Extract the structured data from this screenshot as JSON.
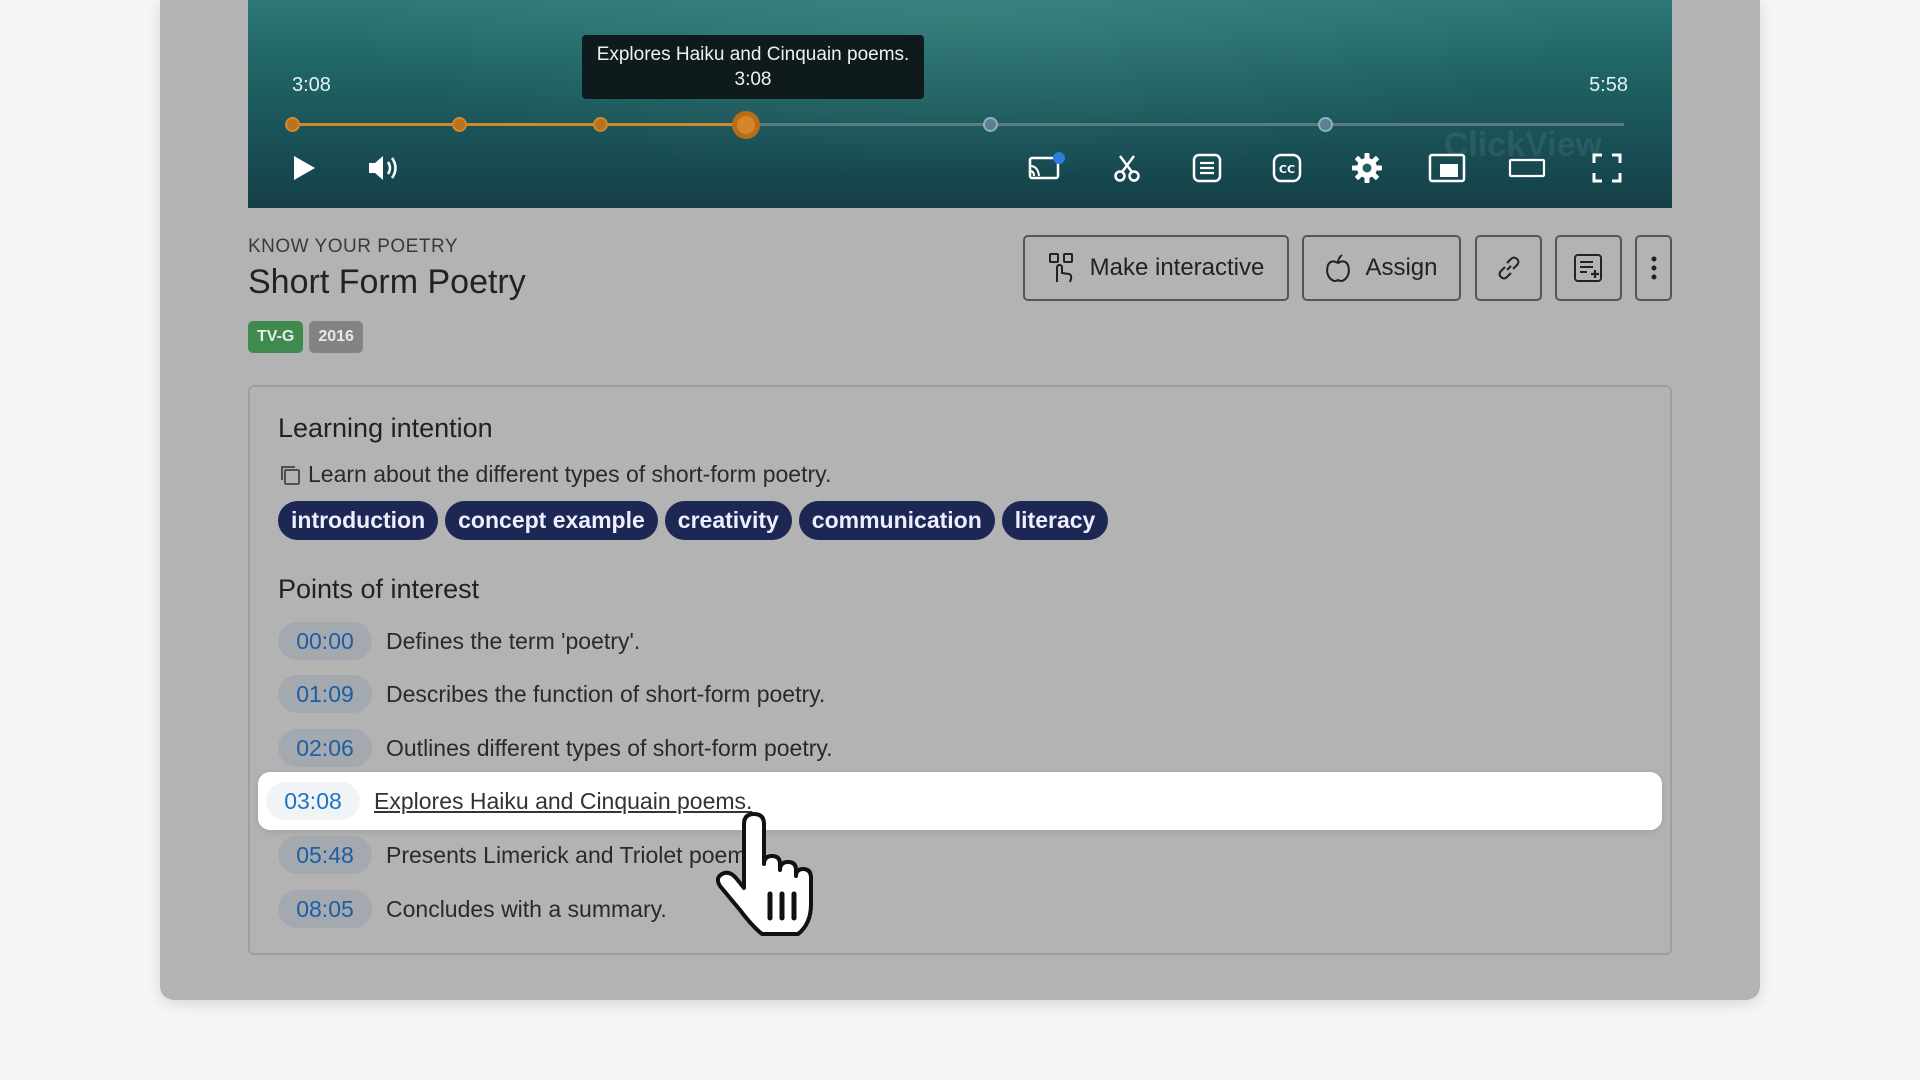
{
  "player": {
    "current_time": "3:08",
    "duration": "5:58",
    "progress_fraction": 0.3408,
    "tooltip_text": "Explores Haiku and Cinquain poems.",
    "tooltip_time": "3:08",
    "chapter_marker_fractions": [
      0,
      0.1256,
      0.2312,
      0.524,
      0.7752
    ],
    "watermark": "ClickView",
    "controls": [
      "play-icon",
      "volume-icon",
      "cast-icon",
      "clip-scissors-icon",
      "transcript-icon",
      "closed-captions-icon",
      "settings-gear-icon",
      "picture-in-picture-icon",
      "theater-mode-icon",
      "fullscreen-icon"
    ],
    "colors": {
      "progress": "#d5862b",
      "cast_dot": "#2b7be0"
    }
  },
  "video": {
    "series": "KNOW YOUR POETRY",
    "title": "Short Form Poetry",
    "rating": "TV-G",
    "year": "2016"
  },
  "toolbar": {
    "make_interactive_label": "Make interactive",
    "assign_label": "Assign"
  },
  "learning": {
    "heading": "Learning intention",
    "text": "Learn about the different types of short-form poetry.",
    "tags": [
      "introduction",
      "concept example",
      "creativity",
      "communication",
      "literacy"
    ]
  },
  "points": {
    "heading": "Points of interest",
    "items": [
      {
        "time": "00:00",
        "desc": "Defines the term 'poetry'."
      },
      {
        "time": "01:09",
        "desc": "Describes the function of short-form poetry."
      },
      {
        "time": "02:06",
        "desc": "Outlines different types of short-form poetry."
      },
      {
        "time": "03:08",
        "desc": "Explores Haiku and Cinquain poems."
      },
      {
        "time": "05:48",
        "desc": "Presents Limerick and Triolet poems."
      },
      {
        "time": "08:05",
        "desc": "Concludes with a summary."
      }
    ]
  }
}
